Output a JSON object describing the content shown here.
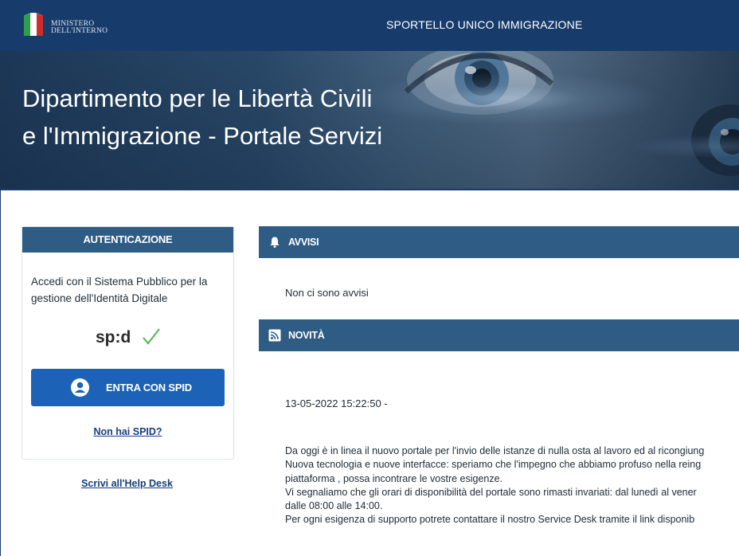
{
  "header": {
    "logo_line1": "MINISTERO",
    "logo_line2": "DELL'INTERNO",
    "site_title": "SPORTELLO UNICO IMMIGRAZIONE",
    "emblem_icon": "italian-flag-emblem"
  },
  "hero": {
    "title_line1": "Dipartimento per le Libertà Civili",
    "title_line2": "e l'Immigrazione - Portale Servizi"
  },
  "auth": {
    "heading": "AUTENTICAZIONE",
    "description": "Accedi con il Sistema Pubblico per la gestione dell'Identità Digitale",
    "logo_text": "sp:d",
    "login_button": "ENTRA CON SPID",
    "no_spid_link": "Non hai SPID?",
    "help_link": "Scrivi all'Help Desk"
  },
  "avvisi": {
    "title": "AVVISI",
    "icon": "bell-icon",
    "empty_text": "Non ci sono avvisi"
  },
  "novita": {
    "title": "NOVITÀ",
    "icon": "rss-icon",
    "date": "13-05-2022 15:22:50 -",
    "lines": [
      "Da oggi è in linea il nuovo portale per l'invio delle istanze di nulla osta al lavoro ed al ricongiung",
      "Nuova tecnologia e nuove interfacce: speriamo che l'impegno che abbiamo profuso nella reing",
      "piattaforma , possa incontrare le vostre esigenze.",
      "Vi segnaliamo che gli orari di disponibilità del portale sono rimasti invariati: dal lunedì al vener",
      "dalle 08:00 alle 14:00.",
      "Per ogni esigenza di supporto potrete contattare il nostro Service Desk tramite il link disponib"
    ]
  },
  "colors": {
    "header_bg": "#173c6c",
    "panel_bar": "#2f5c84",
    "button_blue": "#1c62b6",
    "link_blue": "#153e7c",
    "spid_green": "#5cb85c"
  }
}
